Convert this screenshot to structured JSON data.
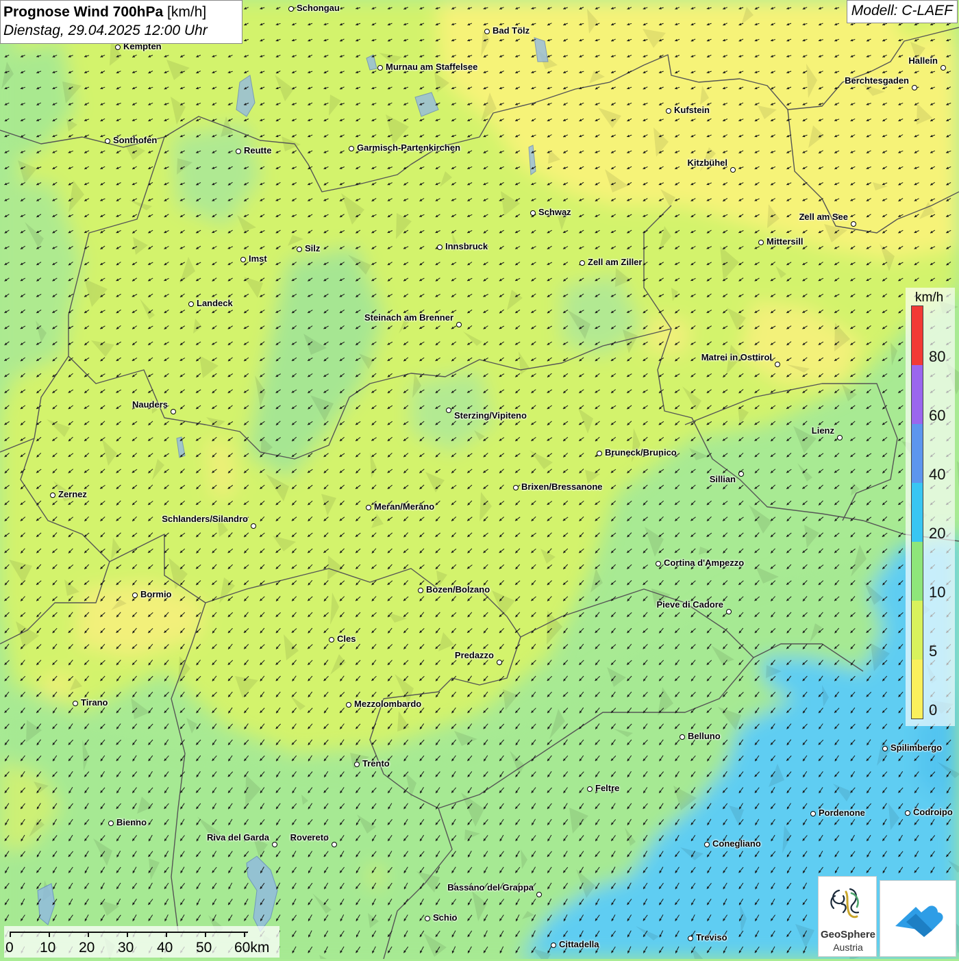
{
  "title": {
    "main": "Prognose Wind 700hPa",
    "unit": "[km/h]",
    "date": "Dienstag, 29.04.2025 12:00 Uhr"
  },
  "model": "Modell: C-LAEF",
  "legend": {
    "unit": "km/h",
    "labels": [
      "80",
      "60",
      "40",
      "20",
      "10",
      "5",
      "0"
    ],
    "colors": [
      "#f23a35",
      "#9a66ee",
      "#5c96ee",
      "#38c6f2",
      "#8ee67a",
      "#d8f25c",
      "#faf05c"
    ]
  },
  "scale_bar": {
    "labels": [
      "0",
      "10",
      "20",
      "30",
      "40",
      "50",
      "60km"
    ]
  },
  "logos": {
    "geosphere_line1": "GeoSphere",
    "geosphere_line2": "Austria"
  },
  "cities": [
    {
      "name": "Schongau"
    },
    {
      "name": "Bad Tölz"
    },
    {
      "name": "Kempten"
    },
    {
      "name": "Murnau am Staffelsee"
    },
    {
      "name": "Hallein"
    },
    {
      "name": "Berchtesgaden"
    },
    {
      "name": "Kufstein"
    },
    {
      "name": "Sonthofen"
    },
    {
      "name": "Reutte"
    },
    {
      "name": "Garmisch-Partenkirchen"
    },
    {
      "name": "Kitzbühel"
    },
    {
      "name": "Schwaz"
    },
    {
      "name": "Zell am See"
    },
    {
      "name": "Mittersill"
    },
    {
      "name": "Innsbruck"
    },
    {
      "name": "Silz"
    },
    {
      "name": "Imst"
    },
    {
      "name": "Zell am Ziller"
    },
    {
      "name": "Landeck"
    },
    {
      "name": "Steinach am Brenner"
    },
    {
      "name": "Matrei in Osttirol"
    },
    {
      "name": "Nauders"
    },
    {
      "name": "Sterzing/Vipiteno"
    },
    {
      "name": "Lienz"
    },
    {
      "name": "Bruneck/Brunico"
    },
    {
      "name": "Sillian"
    },
    {
      "name": "Zernez"
    },
    {
      "name": "Brixen/Bressanone"
    },
    {
      "name": "Meran/Merano"
    },
    {
      "name": "Schlanders/Silandro"
    },
    {
      "name": "Cortina d'Ampezzo"
    },
    {
      "name": "Bormio"
    },
    {
      "name": "Bozen/Bolzano"
    },
    {
      "name": "Pieve di Cadore"
    },
    {
      "name": "Cles"
    },
    {
      "name": "Predazzo"
    },
    {
      "name": "Tirano"
    },
    {
      "name": "Mezzolombardo"
    },
    {
      "name": "Belluno"
    },
    {
      "name": "Spilimbergo"
    },
    {
      "name": "Trento"
    },
    {
      "name": "Feltre"
    },
    {
      "name": "Pordenone"
    },
    {
      "name": "Codroipo"
    },
    {
      "name": "Bienno"
    },
    {
      "name": "Riva del Garda"
    },
    {
      "name": "Rovereto"
    },
    {
      "name": "Conegliano"
    },
    {
      "name": "Bassano del Grappa"
    },
    {
      "name": "Schio"
    },
    {
      "name": "Treviso"
    },
    {
      "name": "Cittadella"
    }
  ]
}
